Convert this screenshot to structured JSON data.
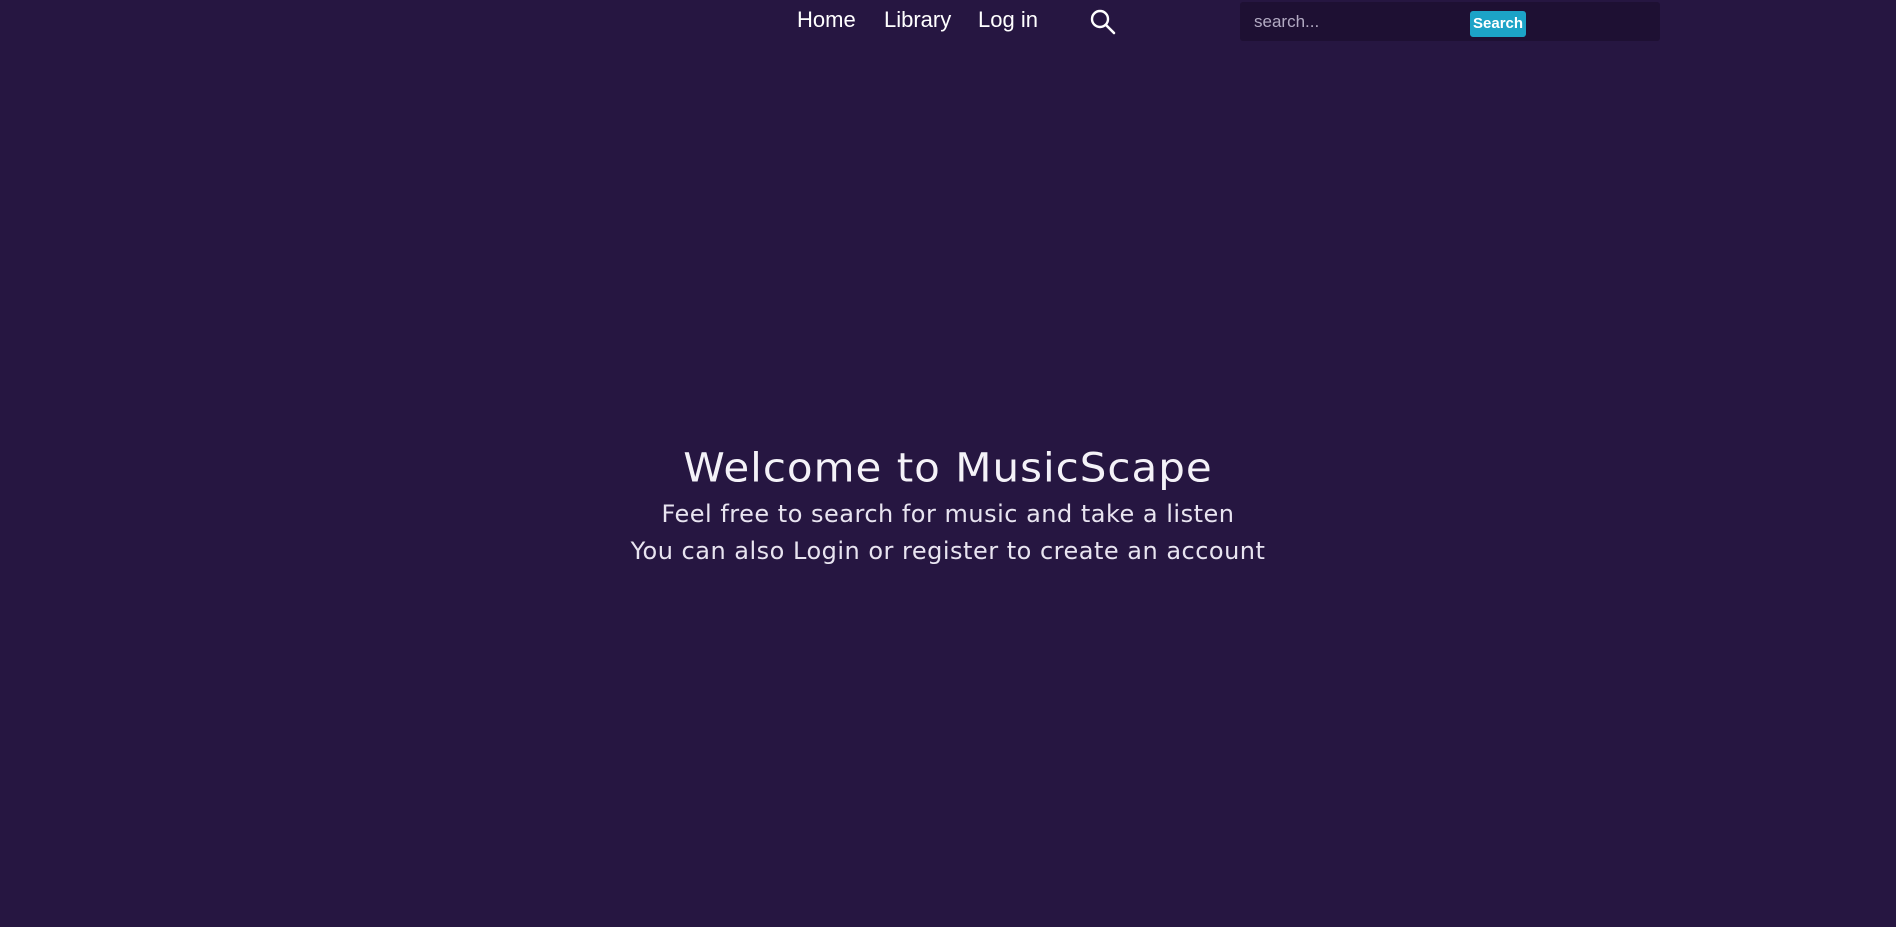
{
  "nav": {
    "home_label": "Home",
    "library_label": "Library",
    "login_label": "Log in",
    "search_icon": "search-icon"
  },
  "search": {
    "placeholder": "search...",
    "value": "",
    "button_label": "Search"
  },
  "hero": {
    "title": "Welcome to MusicScape",
    "line1": "Feel free to search for music and take a listen",
    "line2": "You can also Login or register to create an account"
  },
  "colors": {
    "background": "#261641",
    "search_box_bg": "#1e1033",
    "accent": "#1ca3c7",
    "text": "#ffffff"
  }
}
